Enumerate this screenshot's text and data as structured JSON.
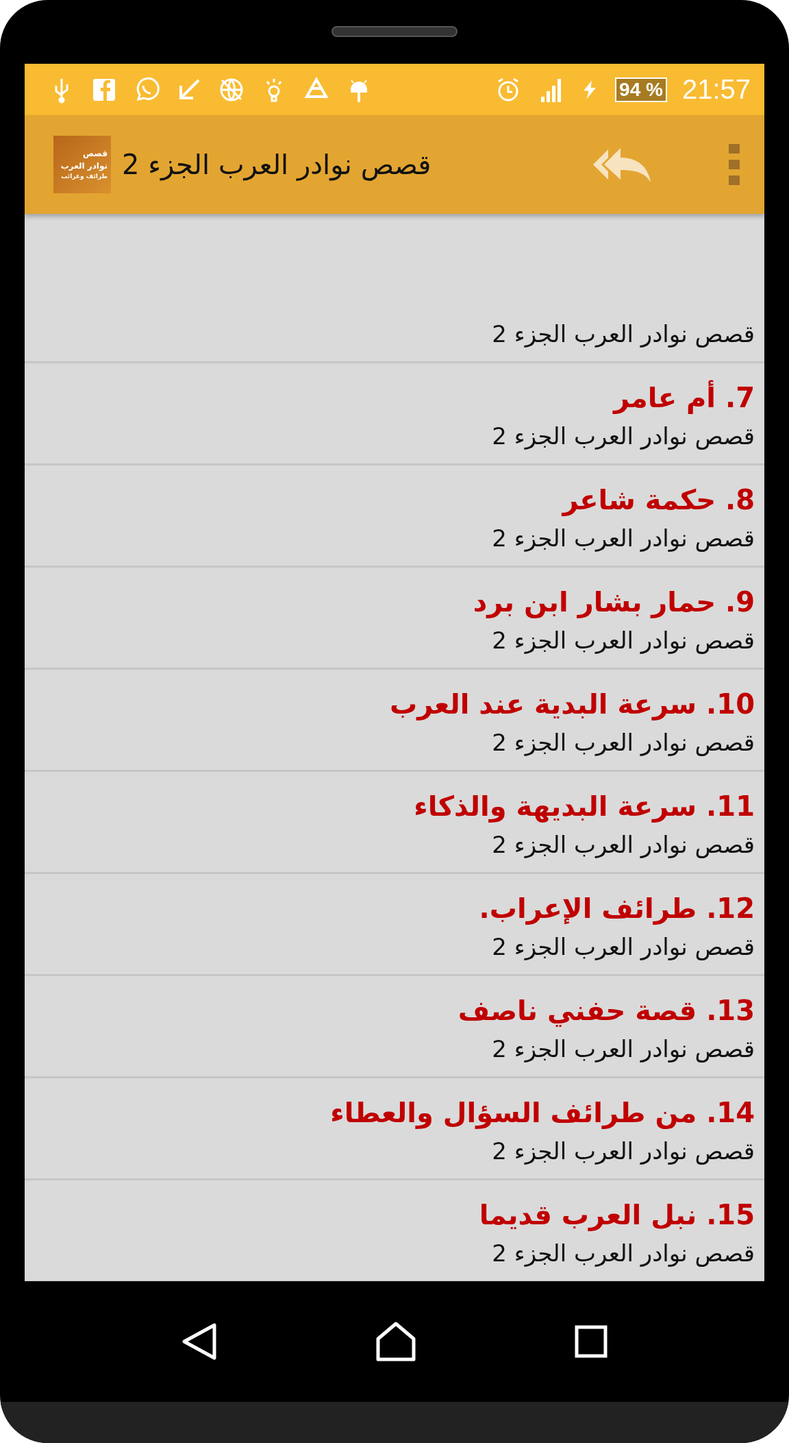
{
  "status_bar": {
    "battery": "94 %",
    "time": "21:57"
  },
  "app_bar": {
    "icon_lines": [
      "قصص",
      "نوادر العرب",
      "طرائف وغرائب"
    ],
    "title": "قصص نوادر العرب الجزء 2"
  },
  "items": [
    {
      "subtitle": "قصص نوادر العرب الجزء 2"
    },
    {
      "title": "7. أم عامر",
      "subtitle": "قصص نوادر العرب الجزء 2"
    },
    {
      "title": "8. حكمة شاعر",
      "subtitle": "قصص نوادر العرب الجزء 2"
    },
    {
      "title": "9. حمار بشار ابن برد",
      "subtitle": "قصص نوادر العرب الجزء 2"
    },
    {
      "title": "10. سرعة البدية عند العرب",
      "subtitle": "قصص نوادر العرب الجزء 2"
    },
    {
      "title": "11. سرعة البديهة والذكاء",
      "subtitle": "قصص نوادر العرب الجزء 2"
    },
    {
      "title": "12. طرائف الإعراب.",
      "subtitle": "قصص نوادر العرب الجزء 2"
    },
    {
      "title": "13. قصة حفني ناصف",
      "subtitle": "قصص نوادر العرب الجزء 2"
    },
    {
      "title": "14. من طرائف السؤال والعطاء",
      "subtitle": "قصص نوادر العرب الجزء 2"
    },
    {
      "title": "15. نبل العرب قديما",
      "subtitle": "قصص نوادر العرب الجزء 2"
    }
  ]
}
